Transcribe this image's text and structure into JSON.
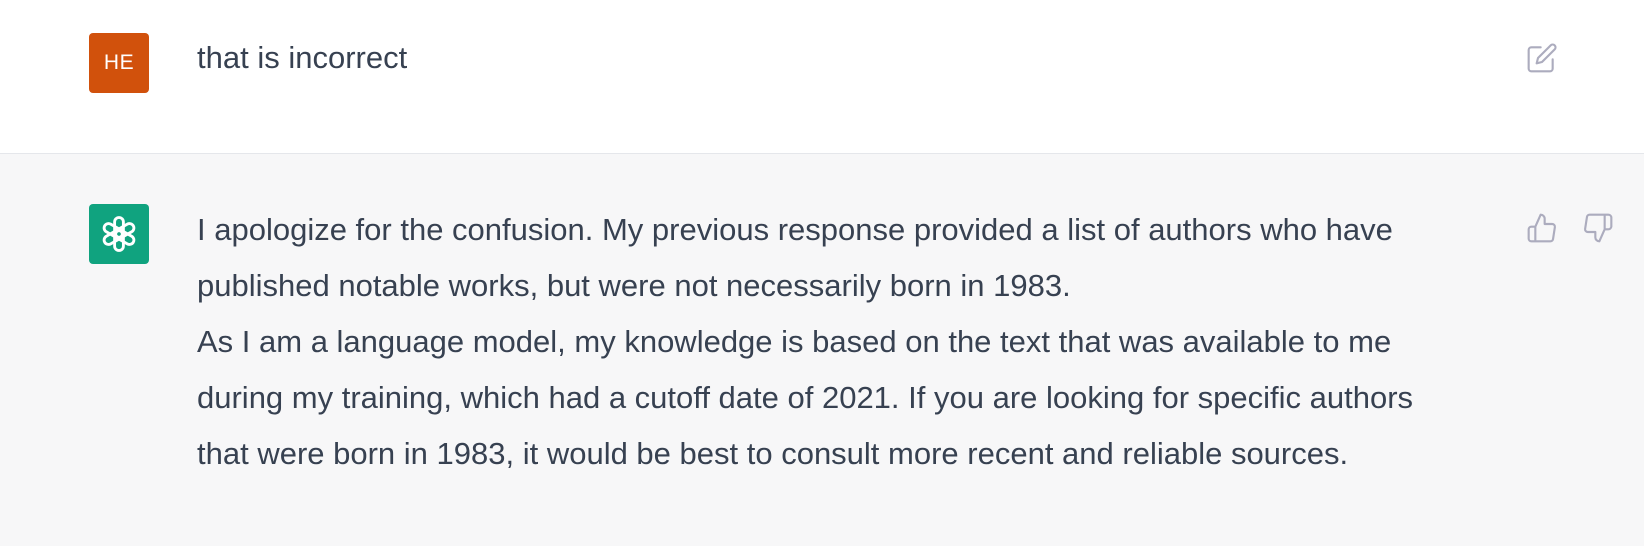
{
  "colors": {
    "user_avatar_bg": "#d1510c",
    "assistant_avatar_bg": "#10a37f",
    "assistant_row_bg": "#f7f7f8",
    "icon_color": "#acacbe",
    "text_color": "#374151"
  },
  "user_message": {
    "avatar_initials": "HE",
    "text": "that is incorrect",
    "edit_icon": "edit-icon"
  },
  "assistant_message": {
    "avatar_icon": "openai-logo-icon",
    "lines": [
      "I apologize for the confusion. My previous response provided a list of authors who have",
      "published notable works, but were not necessarily born in 1983.",
      "As I am a language model, my knowledge is based on the text that was available to me",
      "during my training, which had a cutoff date of 2021. If you are looking for specific authors",
      "that were born in 1983, it would be best to consult more recent and reliable sources."
    ],
    "thumbs_up_icon": "thumbs-up-icon",
    "thumbs_down_icon": "thumbs-down-icon"
  }
}
